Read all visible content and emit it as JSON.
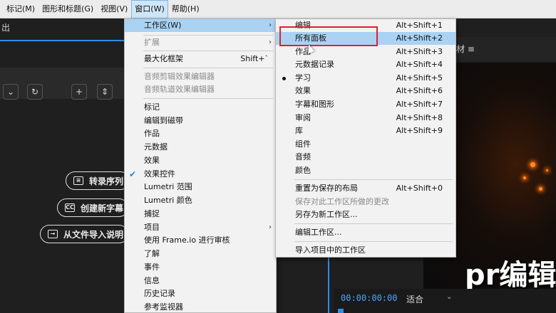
{
  "menubar": {
    "items": [
      {
        "label": "标记(M)",
        "active": false
      },
      {
        "label": "图形和标题(G)",
        "active": false
      },
      {
        "label": "视图(V)",
        "active": false
      },
      {
        "label": "窗口(W)",
        "active": true
      },
      {
        "label": "帮助(H)",
        "active": false
      }
    ]
  },
  "left_panel": {
    "title": "出",
    "pills": [
      "转录序列",
      "创建新字幕",
      "从文件导入说明"
    ]
  },
  "window_menu": {
    "items": [
      {
        "label": "工作区(W)",
        "shortcut": "",
        "submenu": true,
        "state": "highlight"
      },
      {
        "label": "扩展",
        "shortcut": "",
        "submenu": true,
        "state": "disabled"
      },
      {
        "label": "最大化框架",
        "shortcut": "Shift+`",
        "state": "normal"
      },
      {
        "label": "音频剪辑效果编辑器",
        "shortcut": "",
        "state": "disabled"
      },
      {
        "label": "音频轨道效果编辑器",
        "shortcut": "",
        "state": "disabled"
      },
      {
        "label": "标记",
        "shortcut": "",
        "state": "normal"
      },
      {
        "label": "编辑到磁带",
        "shortcut": "",
        "state": "normal"
      },
      {
        "label": "作品",
        "shortcut": "",
        "state": "normal"
      },
      {
        "label": "元数据",
        "shortcut": "",
        "state": "normal"
      },
      {
        "label": "效果",
        "shortcut": "",
        "state": "normal"
      },
      {
        "label": "效果控件",
        "shortcut": "",
        "state": "checked"
      },
      {
        "label": "Lumetri 范围",
        "shortcut": "",
        "state": "normal"
      },
      {
        "label": "Lumetri 颜色",
        "shortcut": "",
        "state": "normal"
      },
      {
        "label": "捕捉",
        "shortcut": "",
        "state": "normal"
      },
      {
        "label": "项目",
        "shortcut": "",
        "submenu": true,
        "state": "normal"
      },
      {
        "label": "使用 Frame.io 进行审核",
        "shortcut": "",
        "state": "normal"
      },
      {
        "label": "了解",
        "shortcut": "",
        "state": "normal"
      },
      {
        "label": "事件",
        "shortcut": "",
        "state": "normal"
      },
      {
        "label": "信息",
        "shortcut": "",
        "state": "normal"
      },
      {
        "label": "历史记录",
        "shortcut": "",
        "state": "normal"
      },
      {
        "label": "参考监视器",
        "shortcut": "",
        "state": "normal"
      }
    ]
  },
  "workspace_menu": {
    "items": [
      {
        "label": "编辑",
        "shortcut": "Alt+Shift+1",
        "state": "normal"
      },
      {
        "label": "所有面板",
        "shortcut": "Alt+Shift+2",
        "state": "highlight"
      },
      {
        "label": "作品",
        "shortcut": "Alt+Shift+3",
        "state": "normal"
      },
      {
        "label": "元数据记录",
        "shortcut": "Alt+Shift+4",
        "state": "normal"
      },
      {
        "label": "学习",
        "shortcut": "Alt+Shift+5",
        "state": "selected"
      },
      {
        "label": "效果",
        "shortcut": "Alt+Shift+6",
        "state": "normal"
      },
      {
        "label": "字幕和图形",
        "shortcut": "Alt+Shift+7",
        "state": "normal"
      },
      {
        "label": "审阅",
        "shortcut": "Alt+Shift+8",
        "state": "normal"
      },
      {
        "label": "库",
        "shortcut": "Alt+Shift+9",
        "state": "normal"
      },
      {
        "label": "组件",
        "shortcut": "",
        "state": "normal"
      },
      {
        "label": "音频",
        "shortcut": "",
        "state": "normal"
      },
      {
        "label": "颜色",
        "shortcut": "",
        "state": "normal"
      },
      {
        "label": "重置为保存的布局",
        "shortcut": "Alt+Shift+0",
        "state": "normal"
      },
      {
        "label": "保存对此工作区所做的更改",
        "shortcut": "",
        "state": "disabled"
      },
      {
        "label": "另存为新工作区...",
        "shortcut": "",
        "state": "normal"
      },
      {
        "label": "编辑工作区...",
        "shortcut": "",
        "state": "normal"
      },
      {
        "label": "导入项目中的工作区",
        "shortcut": "",
        "state": "normal"
      }
    ]
  },
  "preview": {
    "header_label": "材 ≡",
    "overlay_text": "pr编辑",
    "timecode": "00:00:00:00",
    "fit_label": "适合"
  },
  "colors": {
    "highlight": "#a9d2f3",
    "annotation_box": "#e0222a",
    "accent_blue": "#2d8ceb"
  }
}
